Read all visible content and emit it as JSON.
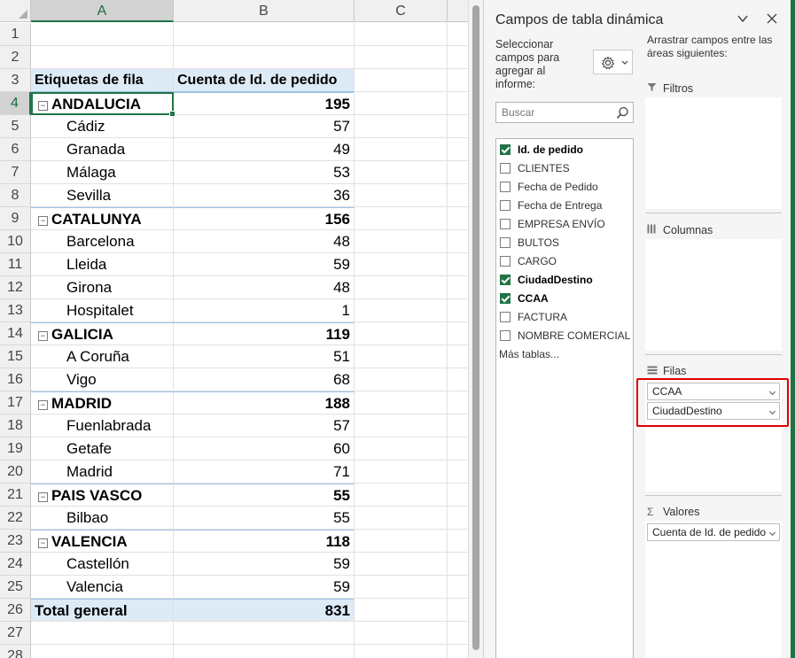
{
  "sheet": {
    "columns": [
      "A",
      "B",
      "C"
    ],
    "row_numbers": [
      "1",
      "2",
      "3",
      "4",
      "5",
      "6",
      "7",
      "8",
      "9",
      "10",
      "11",
      "12",
      "13",
      "14",
      "15",
      "16",
      "17",
      "18",
      "19",
      "20",
      "21",
      "22",
      "23",
      "24",
      "25",
      "26",
      "27",
      "28"
    ],
    "header": {
      "label": "Etiquetas de fila",
      "value": "Cuenta de Id. de pedido"
    },
    "rows": [
      {
        "label": "ANDALUCIA",
        "value": "195",
        "type": "group"
      },
      {
        "label": "Cádiz",
        "value": "57",
        "type": "item"
      },
      {
        "label": "Granada",
        "value": "49",
        "type": "item"
      },
      {
        "label": "Málaga",
        "value": "53",
        "type": "item"
      },
      {
        "label": "Sevilla",
        "value": "36",
        "type": "item"
      },
      {
        "label": "CATALUNYA",
        "value": "156",
        "type": "group"
      },
      {
        "label": "Barcelona",
        "value": "48",
        "type": "item"
      },
      {
        "label": "Lleida",
        "value": "59",
        "type": "item"
      },
      {
        "label": "Girona",
        "value": "48",
        "type": "item"
      },
      {
        "label": "Hospitalet",
        "value": "1",
        "type": "item"
      },
      {
        "label": "GALICIA",
        "value": "119",
        "type": "group"
      },
      {
        "label": "A Coruña",
        "value": "51",
        "type": "item"
      },
      {
        "label": "Vigo",
        "value": "68",
        "type": "item"
      },
      {
        "label": "MADRID",
        "value": "188",
        "type": "group"
      },
      {
        "label": "Fuenlabrada",
        "value": "57",
        "type": "item"
      },
      {
        "label": "Getafe",
        "value": "60",
        "type": "item"
      },
      {
        "label": "Madrid",
        "value": "71",
        "type": "item"
      },
      {
        "label": "PAIS VASCO",
        "value": "55",
        "type": "group"
      },
      {
        "label": "Bilbao",
        "value": "55",
        "type": "item"
      },
      {
        "label": "VALENCIA",
        "value": "118",
        "type": "group"
      },
      {
        "label": "Castellón",
        "value": "59",
        "type": "item"
      },
      {
        "label": "Valencia",
        "value": "59",
        "type": "item"
      }
    ],
    "total": {
      "label": "Total general",
      "value": "831"
    },
    "collapse_glyph": "⊟",
    "active_cell": "A4"
  },
  "pane": {
    "title": "Campos de tabla dinámica",
    "select_label": "Seleccionar campos para agregar al informe:",
    "search_placeholder": "Buscar",
    "fields": [
      {
        "name": "Id. de pedido",
        "checked": true
      },
      {
        "name": "CLIENTES",
        "checked": false
      },
      {
        "name": "Fecha de Pedido",
        "checked": false
      },
      {
        "name": "Fecha de Entrega",
        "checked": false
      },
      {
        "name": "EMPRESA ENVÍO",
        "checked": false
      },
      {
        "name": "BULTOS",
        "checked": false
      },
      {
        "name": "CARGO",
        "checked": false
      },
      {
        "name": "CiudadDestino",
        "checked": true
      },
      {
        "name": "CCAA",
        "checked": true
      },
      {
        "name": "FACTURA",
        "checked": false
      },
      {
        "name": "NOMBRE COMERCIAL",
        "checked": false
      }
    ],
    "more_tables": "Más tablas...",
    "drag_label": "Arrastrar campos entre las áreas siguientes:",
    "areas": {
      "filters": {
        "label": "Filtros",
        "items": []
      },
      "columns": {
        "label": "Columnas",
        "items": []
      },
      "rows": {
        "label": "Filas",
        "items": [
          "CCAA",
          "CiudadDestino"
        ]
      },
      "values": {
        "label": "Valores",
        "items": [
          "Cuenta de Id. de pedido"
        ]
      }
    },
    "highlight_color": "#e00000",
    "accent_color": "#217346"
  }
}
